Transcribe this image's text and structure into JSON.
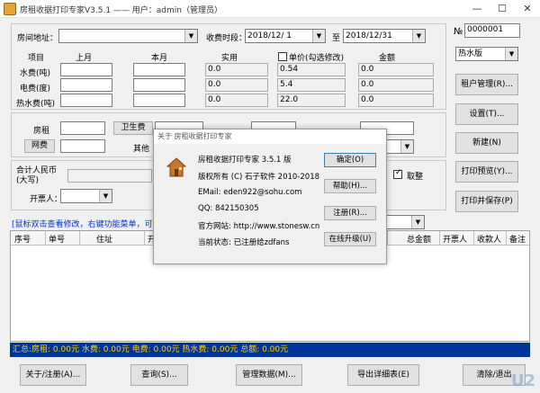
{
  "window": {
    "title": "房租收据打印专家V3.5.1 —— 用户：admin（管理员）",
    "minimize": "—",
    "maximize": "☐",
    "close": "✕"
  },
  "form": {
    "room_label": "房间地址：",
    "room_value": "",
    "period_label": "收费时段：",
    "date_from": "2018/12/ 1",
    "to_label": "至",
    "date_to": "2018/12/31",
    "no_label": "№",
    "no_value": "0000001",
    "headers": {
      "item": "项目",
      "last_month": "上月",
      "this_month": "本月",
      "actual": "实用",
      "unit_price_check": "单价(勾选修改)",
      "amount": "金额"
    },
    "rows": [
      {
        "label": "水费(吨)",
        "last": "",
        "current": "",
        "actual": "0.0",
        "price": "0.54",
        "amount": "0.0"
      },
      {
        "label": "电费(度)",
        "last": "",
        "current": "",
        "actual": "0.0",
        "price": "5.4",
        "amount": "0.0"
      },
      {
        "label": "热水费(吨)",
        "last": "",
        "current": "",
        "actual": "0.0",
        "price": "22.0",
        "amount": "0.0"
      }
    ],
    "fees": {
      "rent_label": "房租",
      "sanitation_label": "卫生费",
      "network_label": "网费",
      "other_label": "其他"
    },
    "total_rmb_label": "合计人民币\n(大写)",
    "round_label": "取整",
    "drawer_label": "开票人：",
    "hint": "[鼠标双击查看修改，右键功能菜单，可按住"
  },
  "right_panel": {
    "type_select": "热水版",
    "buttons": [
      "租户管理(R)...",
      "设置(T)...",
      "新建(N)",
      "打印预览(Y)...",
      "打印并保存(P)"
    ]
  },
  "grid": {
    "columns": [
      "序号",
      "单号",
      "住址",
      "开票",
      "总金额",
      "开票人",
      "收款人",
      "备注"
    ],
    "summary": "汇总:房租: 0.00元  水费: 0.00元  电费: 0.00元  热水费: 0.00元  总额: 0.00元"
  },
  "bottom_buttons": [
    "关于/注册(A)...",
    "查询(S)...",
    "管理数据(M)...",
    "导出详细表(E)",
    "清除/退出"
  ],
  "dialog": {
    "title": "关于 房租收据打印专家",
    "lines": [
      "房租收据打印专家 3.5.1 版",
      "版权所有 (C) 石子软件 2010-2018",
      "EMail:  eden922@sohu.com",
      "QQ:  842150305",
      "官方网站: http://www.stonesw.cn",
      "当前状态: 已注册给zdfans"
    ],
    "buttons": [
      "确定(O)",
      "帮助(H)...",
      "注册(R)...",
      "在线升级(U)"
    ]
  },
  "watermark": "U2"
}
